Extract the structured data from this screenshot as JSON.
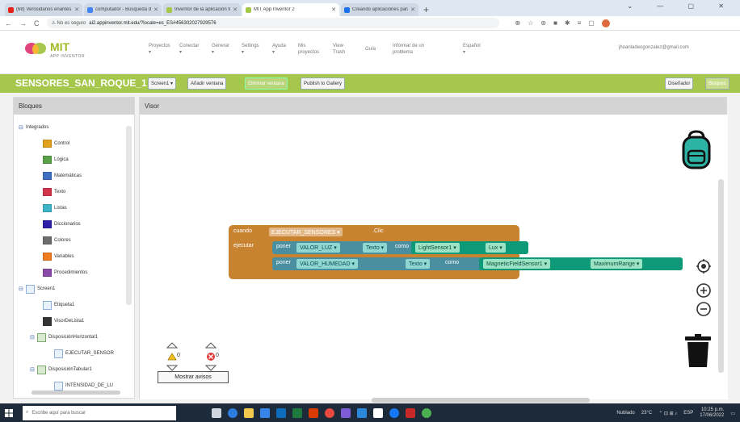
{
  "browser": {
    "tabs": [
      {
        "title": "(68) Verosidanos enantes",
        "favicon_color": "#e62117"
      },
      {
        "title": "computador - Búsqueda de Go",
        "favicon_color": "#4285f4"
      },
      {
        "title": "Inventor de la aplicación MIT",
        "favicon_color": "#a5c74c"
      },
      {
        "title": "MIT App Inventor 2",
        "favicon_color": "#a5c74c"
      },
      {
        "title": "Creando aplicaciones para móvil",
        "favicon_color": "#1a73e8"
      }
    ],
    "new_tab": "+",
    "window_controls": "⌄ — ▢ ✕",
    "nav": {
      "back": "←",
      "forward": "→",
      "reload": "C"
    },
    "url": {
      "security": "⚠ No es seguro",
      "host": "ai2.appinventor.mit.edu/?locale=es_ES#456302027929576"
    },
    "ext_icons": [
      "⊕",
      "☆",
      "⊛",
      "■",
      "✱",
      "≡",
      "▢"
    ]
  },
  "app_header": {
    "logo_title": "MIT",
    "logo_subtitle": "APP INVENTOR",
    "menu": [
      "Proyectos\n▾",
      "Conectar\n▾",
      "Generar\n▾",
      "Settings\n▾",
      "Ayuda\n▾",
      "Mis\nproyectos",
      "View\nTrash",
      "Guía",
      "Informar de un\nproblema",
      "Español\n▾"
    ],
    "email": "jhoanladeogonzalez@gmail.com"
  },
  "toolbar": {
    "project_name": "SENSORES_SAN_ROQUE_1",
    "screen_dropdown": "Screen1 ▾",
    "add_screen": "Añadir ventana",
    "remove_screen": "Eliminar ventana",
    "publish": "Publish to Gallery",
    "designer": "Diseñador",
    "blocks": "Bloques"
  },
  "blocks_panel": {
    "title": "Bloques",
    "builtin_label": "Integrados",
    "builtin": [
      {
        "label": "Control",
        "color": "#e2a11c"
      },
      {
        "label": "Lógica",
        "color": "#5ba14a"
      },
      {
        "label": "Matemáticas",
        "color": "#3f6fc0"
      },
      {
        "label": "Texto",
        "color": "#d2344c"
      },
      {
        "label": "Listas",
        "color": "#3db4c8"
      },
      {
        "label": "Diccionarios",
        "color": "#2d1fa8"
      },
      {
        "label": "Colores",
        "color": "#6d6d6d"
      },
      {
        "label": "Variables",
        "color": "#f07c22"
      },
      {
        "label": "Procedimientos",
        "color": "#8a4aa8"
      }
    ],
    "components": [
      {
        "label": "Screen1",
        "level": 0,
        "toggle": "⊟"
      },
      {
        "label": "Etiqueta1",
        "level": 1
      },
      {
        "label": "VisorDeLista1",
        "level": 1
      },
      {
        "label": "DisposiciónHorizontal1",
        "level": 1,
        "toggle": "⊟"
      },
      {
        "label": "EJECUTAR_SENSOR",
        "level": 2
      },
      {
        "label": "DisposiciónTabular1",
        "level": 1,
        "toggle": "⊟"
      },
      {
        "label": "INTENSIDAD_DE_LU",
        "level": 2
      }
    ]
  },
  "viewer": {
    "title": "Visor",
    "event_block": {
      "cuando": "cuando",
      "component": "EJECUTAR_SENSORES ▾",
      "event": ".Clic",
      "ejecutar": "ejecutar",
      "statements": [
        {
          "poner": "poner",
          "var": "VALOR_LUZ ▾",
          "prop": "Texto ▾",
          "como": "como",
          "sensor": "LightSensor1 ▾",
          "sensor_prop": "Lux ▾"
        },
        {
          "poner": "poner",
          "var": "VALOR_HUMEDAD ▾",
          "prop": "Texto ▾",
          "como": "como",
          "sensor": "MagneticFieldSensor1 ▾",
          "sensor_prop": "MaximumRange ▾"
        }
      ]
    },
    "warnings_count": "0",
    "errors_count": "0",
    "show_warnings": "Mostrar avisos"
  },
  "taskbar": {
    "search_placeholder": "Escribe aquí para buscar",
    "weather": "Nublado",
    "temp": "23°C",
    "lang": "ESP",
    "time": "10:25 p.m.",
    "date": "17/06/2022"
  }
}
